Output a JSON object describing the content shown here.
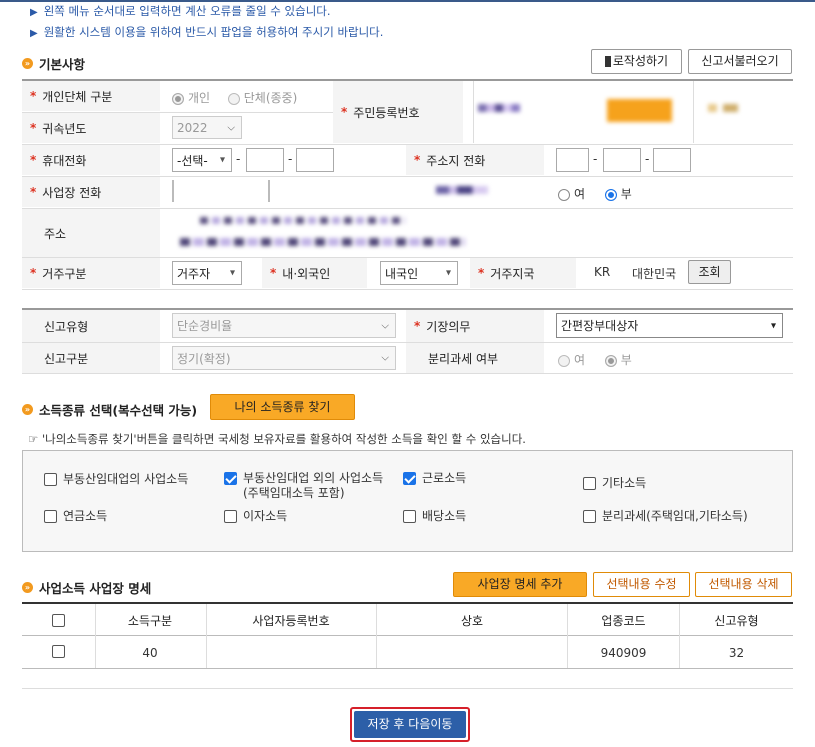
{
  "notices": [
    "왼쪽 메뉴 순서대로 입력하면 계산 오류를 줄일 수 있습니다.",
    "원활한 시스템 이용을 위하여 반드시 팝업을 허용하여 주시기 바랍니다."
  ],
  "basic": {
    "title": "기본사항",
    "btn_write": "로작성하기",
    "btn_load": "신고서불러오기",
    "personal_type_label": "개인단체 구분",
    "radio_individual": "개인",
    "radio_group": "단체(종중)",
    "ssn_label": "주민등록번호",
    "year_label": "귀속년도",
    "year_value": "2022",
    "mobile_label": "휴대전화",
    "mobile_select": "-선택-",
    "dash": "-",
    "home_phone_label": "주소지 전화",
    "biz_phone_label": "사업장 전화",
    "yes": "여",
    "no": "부",
    "address_label": "주소",
    "residence_label": "거주구분",
    "residence_value": "거주자",
    "domestic_label": "내·외국인",
    "domestic_value": "내국인",
    "country_label": "거주지국",
    "country_code": "KR",
    "country_name": "대한민국",
    "btn_lookup": "조회",
    "filing_type_label": "신고유형",
    "filing_type_value": "단순경비율",
    "bookkeeping_label": "기장의무",
    "bookkeeping_value": "간편장부대상자",
    "report_kind_label": "신고구분",
    "report_kind_value": "정기(확정)",
    "separate_tax_label": "분리과세 여부"
  },
  "income": {
    "title": "소득종류 선택(복수선택 가능)",
    "btn_find": "나의 소득종류 찾기",
    "hint": "☞ '나의소득종류 찾기'버튼을 클릭하면 국세청 보유자료를 활용하여 작성한 소득을 확인 할 수 있습니다.",
    "items": [
      {
        "label": "부동산임대업의 사업소득",
        "checked": false
      },
      {
        "label": "부동산임대업 외의 사업소득",
        "sub": "(주택임대소득 포함)",
        "checked": true
      },
      {
        "label": "근로소득",
        "checked": true
      },
      {
        "label": "기타소득",
        "checked": false
      },
      {
        "label": "연금소득",
        "checked": false
      },
      {
        "label": "이자소득",
        "checked": false
      },
      {
        "label": "배당소득",
        "checked": false
      },
      {
        "label": "분리과세(주택임대,기타소득)",
        "checked": false
      }
    ]
  },
  "business": {
    "title": "사업소득 사업장 명세",
    "btn_add": "사업장 명세 추가",
    "btn_edit": "선택내용 수정",
    "btn_delete": "선택내용 삭제",
    "columns": [
      "소득구분",
      "사업자등록번호",
      "상호",
      "업종코드",
      "신고유형"
    ],
    "rows": [
      {
        "income_type": "40",
        "biz_no": "",
        "name": "",
        "industry_code": "940909",
        "filing_type": "32"
      }
    ]
  },
  "footer": {
    "btn_save_next": "저장 후 다음이동"
  },
  "colors": {
    "accent_orange": "#f9a926",
    "notice_blue": "#2b5aa8",
    "save_button": "#2c5fa8",
    "save_border": "#d6202a"
  }
}
